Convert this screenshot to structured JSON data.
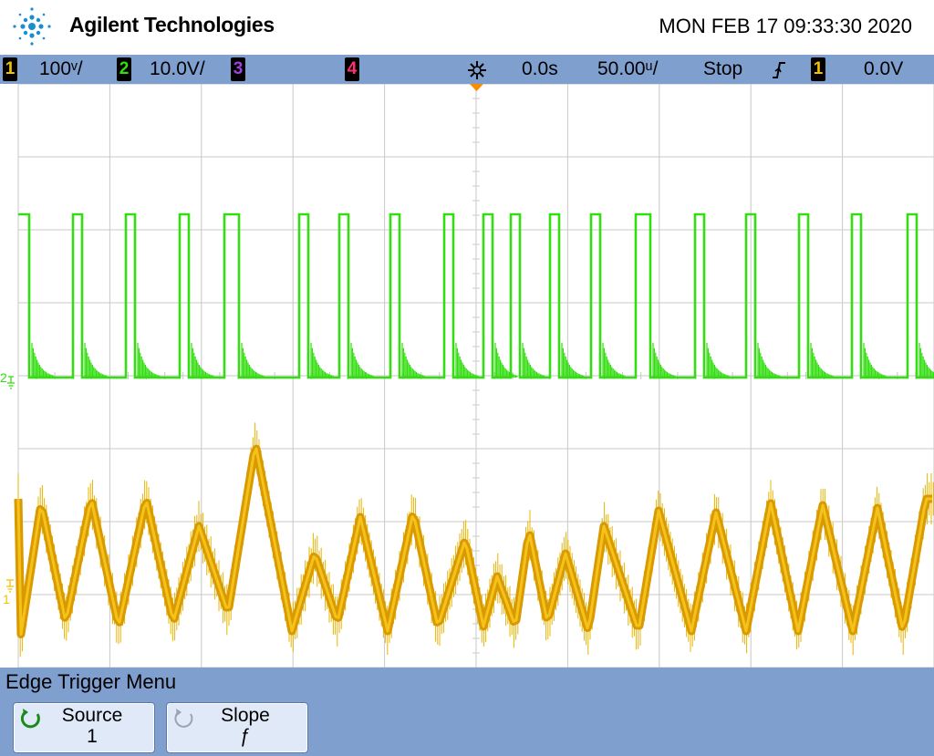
{
  "header": {
    "brand": "Agilent Technologies",
    "datetime": "MON FEB 17 09:33:30 2020"
  },
  "status": {
    "ch1": {
      "number": "1",
      "scale": "100ᵛ/",
      "color": "#f2c200"
    },
    "ch2": {
      "number": "2",
      "scale": "10.0V/",
      "color": "#33dd11"
    },
    "ch3": {
      "number": "3",
      "color": "#a040e0"
    },
    "ch4": {
      "number": "4",
      "color": "#ff3070"
    },
    "acq_icon": "acquisition-star-icon",
    "time_delay": "0.0s",
    "time_scale": "50.00ᵘ/",
    "run_state": "Stop",
    "trigger_slope_icon": "rising-edge-icon",
    "trigger_source": "1",
    "trigger_level": "0.0V"
  },
  "screen": {
    "ch2_marker": "2",
    "ch1_marker": "1",
    "trace_colors": {
      "ch1": "#e8b400",
      "ch1_core": "#d89a00",
      "ch2": "#33dd11"
    }
  },
  "menu": {
    "title": "Edge Trigger Menu",
    "softkeys": [
      {
        "label": "Source",
        "value": "1",
        "icon": "rotate-knob-icon"
      },
      {
        "label": "Slope",
        "value": "ƒ",
        "icon": "rotate-knob-icon"
      }
    ]
  }
}
